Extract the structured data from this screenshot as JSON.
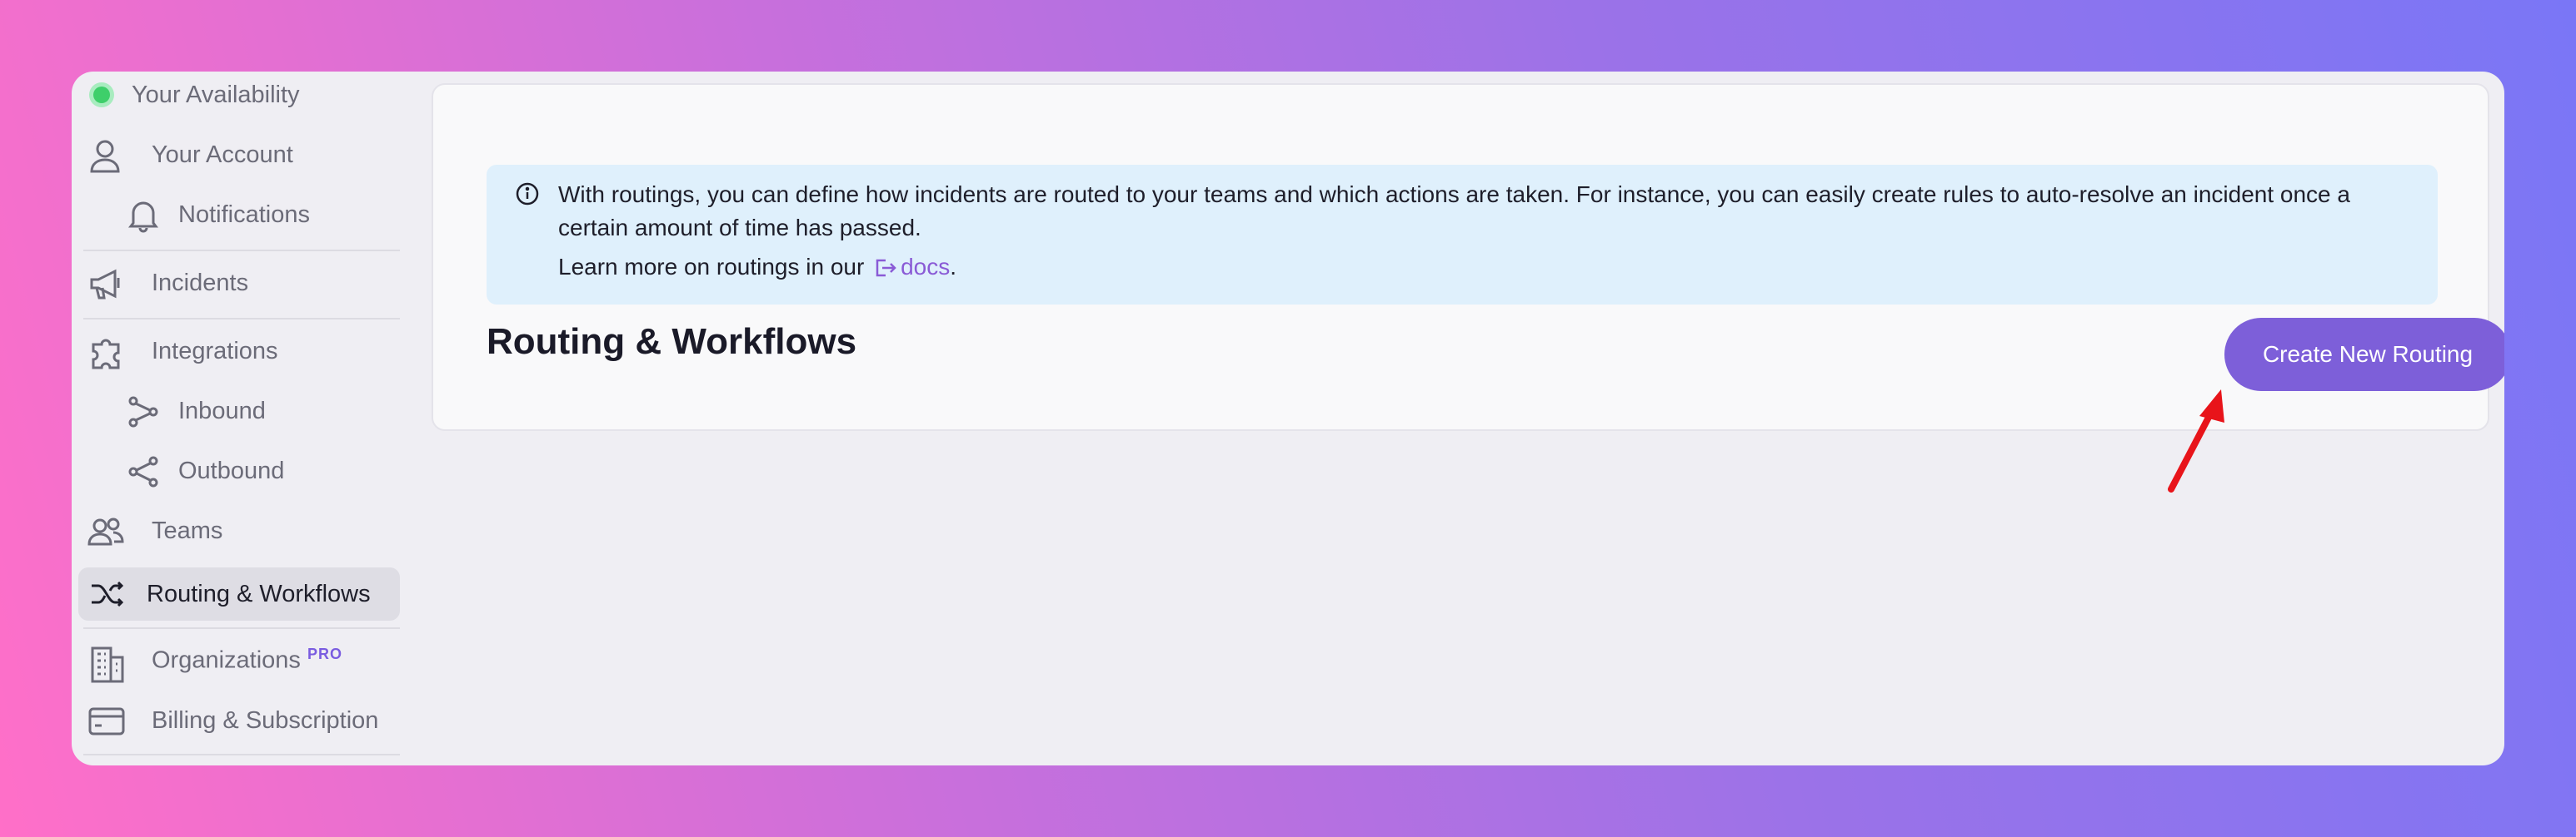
{
  "sidebar": {
    "availability_label": "Your Availability",
    "items": [
      {
        "label": "Your Account",
        "icon": "user-icon"
      },
      {
        "label": "Notifications",
        "icon": "bell-icon"
      },
      {
        "label": "Incidents",
        "icon": "megaphone-icon"
      },
      {
        "label": "Integrations",
        "icon": "puzzle-icon"
      },
      {
        "label": "Inbound",
        "icon": "inbound-icon"
      },
      {
        "label": "Outbound",
        "icon": "share-icon"
      },
      {
        "label": "Teams",
        "icon": "users-icon"
      },
      {
        "label": "Routing & Workflows",
        "icon": "shuffle-icon",
        "active": true
      },
      {
        "label": "Organizations",
        "icon": "building-icon",
        "badge": "PRO"
      },
      {
        "label": "Billing & Subscription",
        "icon": "credit-card-icon"
      }
    ]
  },
  "banner": {
    "text": "With routings, you can define how incidents are routed to your teams and which actions are taken. For instance, you can easily create rules to auto-resolve an incident once a certain amount of time has passed.",
    "learn_more_prefix": "Learn more on routings in our",
    "docs_link": "docs",
    "suffix": "."
  },
  "main": {
    "title": "Routing & Workflows",
    "create_button": "Create New Routing"
  },
  "colors": {
    "accent": "#7d5fd9",
    "banner_bg": "#dff0fc",
    "status_online": "#3ecf6a",
    "arrow": "#e8141a"
  }
}
